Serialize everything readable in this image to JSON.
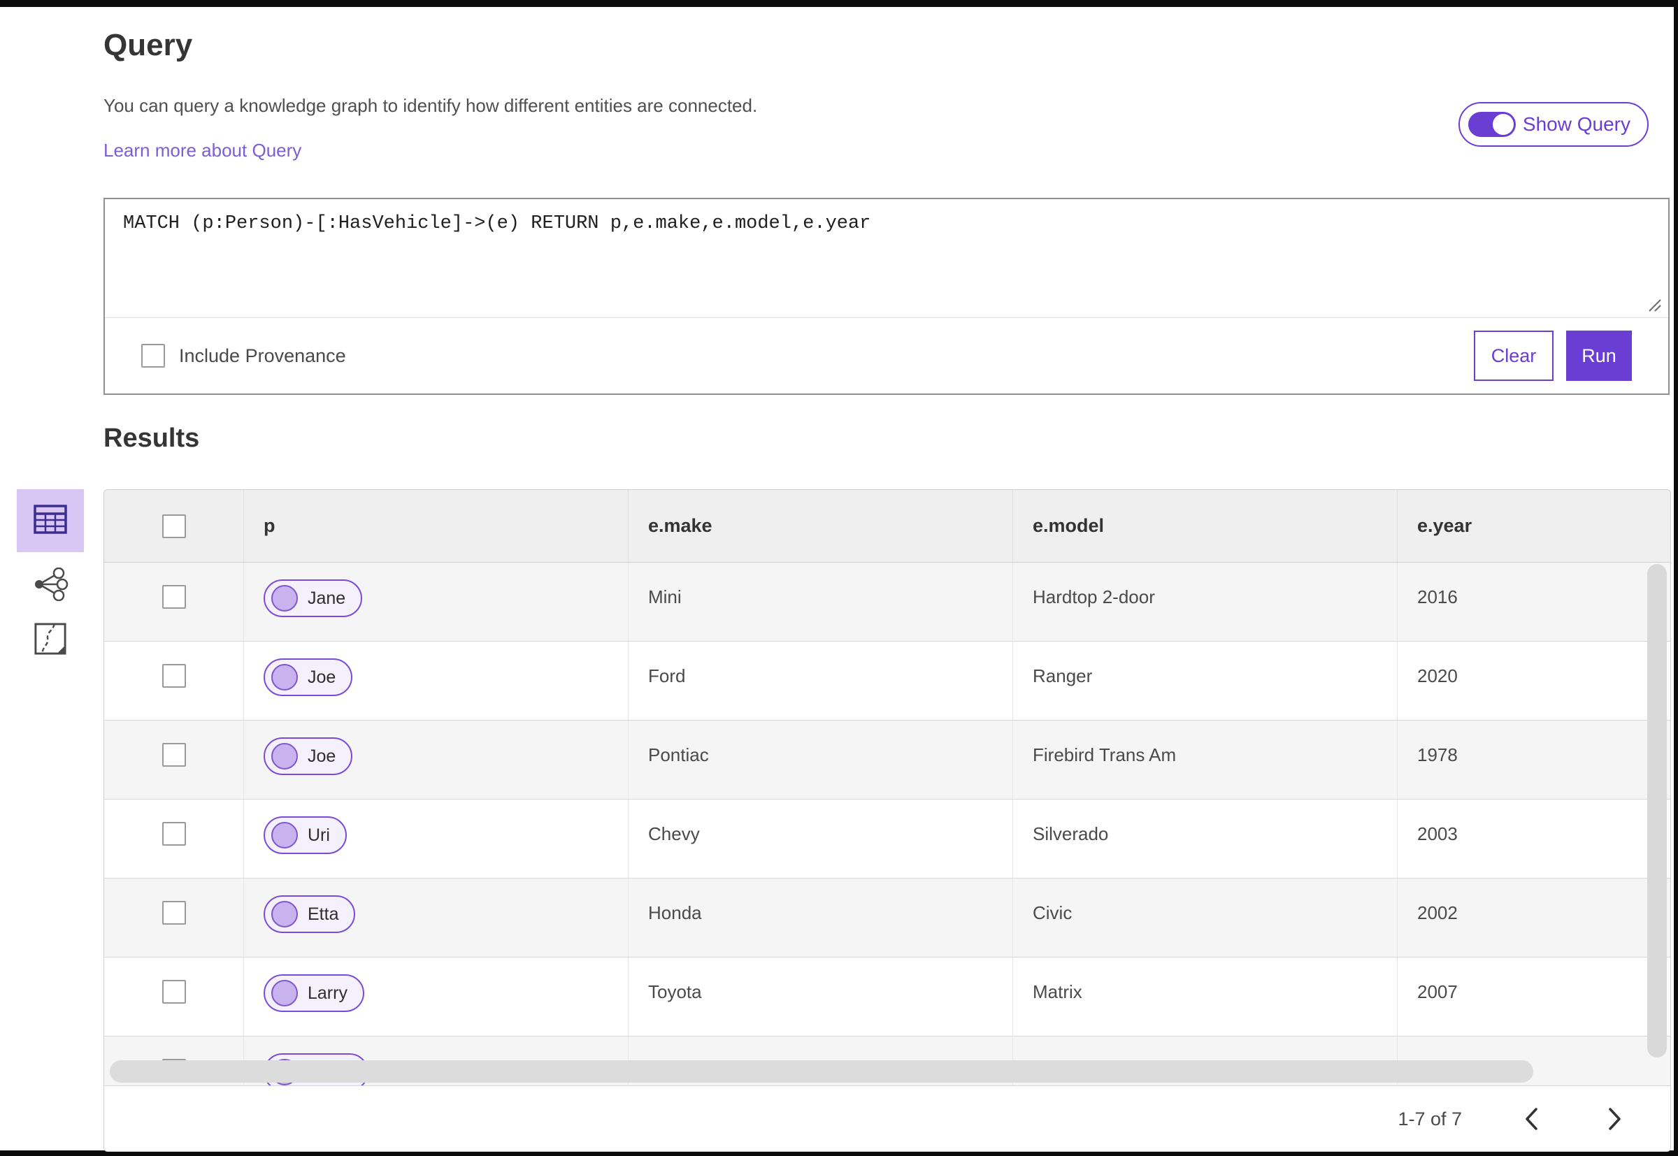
{
  "header": {
    "title": "Query",
    "description": "You can query a knowledge graph to identify how different entities are connected.",
    "learn_more_link": "Learn more about Query",
    "show_query_toggle": {
      "label": "Show Query",
      "state": "on"
    }
  },
  "query_editor": {
    "query_text": "MATCH (p:Person)-[:HasVehicle]->(e) RETURN p,e.make,e.model,e.year",
    "include_provenance": {
      "label": "Include Provenance",
      "checked": false
    },
    "buttons": {
      "clear": "Clear",
      "run": "Run"
    }
  },
  "results": {
    "heading": "Results",
    "view_switcher": [
      {
        "name": "table-view",
        "selected": true
      },
      {
        "name": "link-chart-view",
        "selected": false
      },
      {
        "name": "map-view",
        "selected": false
      }
    ],
    "table": {
      "columns": [
        "p",
        "e.make",
        "e.model",
        "e.year"
      ],
      "rows": [
        {
          "p": "Jane",
          "e_make": "Mini",
          "e_model": "Hardtop 2-door",
          "e_year": "2016"
        },
        {
          "p": "Joe",
          "e_make": "Ford",
          "e_model": "Ranger",
          "e_year": "2020"
        },
        {
          "p": "Joe",
          "e_make": "Pontiac",
          "e_model": "Firebird Trans Am",
          "e_year": "1978"
        },
        {
          "p": "Uri",
          "e_make": "Chevy",
          "e_model": "Silverado",
          "e_year": "2003"
        },
        {
          "p": "Etta",
          "e_make": "Honda",
          "e_model": "Civic",
          "e_year": "2002"
        },
        {
          "p": "Larry",
          "e_make": "Toyota",
          "e_model": "Matrix",
          "e_year": "2007"
        }
      ]
    },
    "pagination": {
      "range_label": "1-7 of 7"
    }
  },
  "colors": {
    "accent_purple": "#6b3ed3",
    "link_purple": "#7b5dd6",
    "selected_view_bg": "#d8c6f4",
    "icon_purple": "#3c2d8f",
    "header_bg": "#efefef",
    "row_alt_bg": "#f5f5f5",
    "pill_bg": "#f5f1fc",
    "pill_border": "#7a4bd8",
    "pill_circle_fill": "#c9b3ee"
  }
}
